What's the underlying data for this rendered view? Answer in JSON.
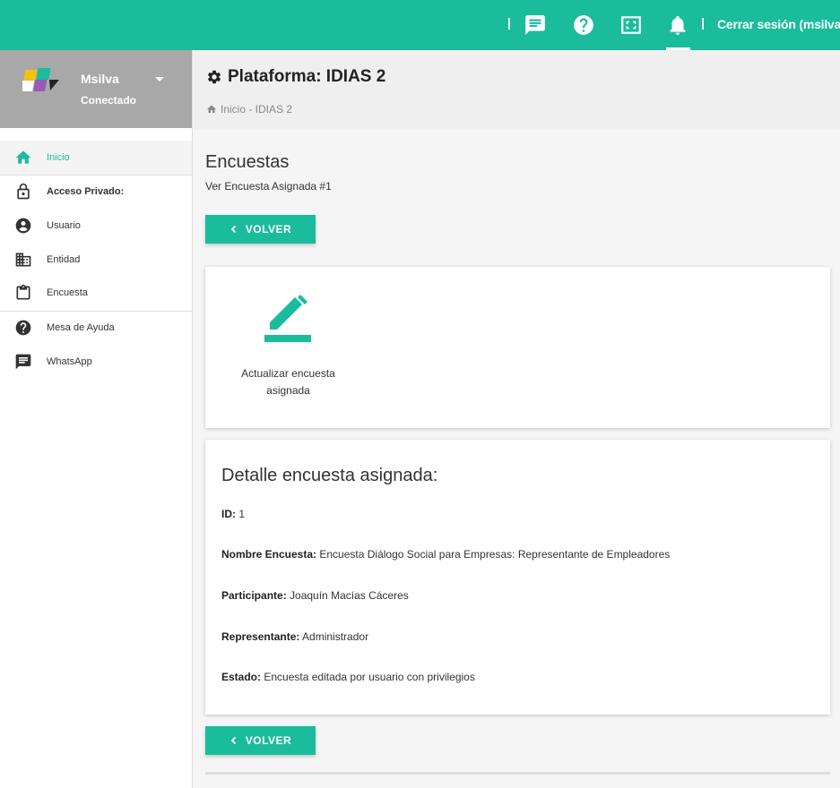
{
  "topbar": {
    "logout_label": "Cerrar sesión (msilva)",
    "icons": [
      "chat-icon",
      "help-icon",
      "fullscreen-icon",
      "bell-icon"
    ],
    "accent": "#1abc9c"
  },
  "user": {
    "name": "Msilva",
    "status": "Conectado"
  },
  "sidebar": {
    "items": [
      {
        "label": "Inicio",
        "icon": "home-icon",
        "active": true
      },
      {
        "label": "Acceso Privado:",
        "icon": "lock-icon",
        "section": true
      },
      {
        "label": "Usuario",
        "icon": "user-circle-icon"
      },
      {
        "label": "Entidad",
        "icon": "building-icon"
      },
      {
        "label": "Encuesta",
        "icon": "clipboard-icon"
      },
      {
        "label": "Mesa de Ayuda",
        "icon": "help-icon"
      },
      {
        "label": "WhatsApp",
        "icon": "chat-icon"
      }
    ]
  },
  "header": {
    "title": "Plataforma: IDIAS 2",
    "breadcrumb": "Inicio - IDIAS 2"
  },
  "main": {
    "section_title": "Encuestas",
    "section_subtitle": "Ver Encuesta Asignada #1",
    "back_label": "VOLVER",
    "action": {
      "label": "Actualizar encuesta asignada",
      "icon": "edit-pencil-icon"
    },
    "detail": {
      "title": "Detalle encuesta asignada:",
      "id_label": "ID:",
      "id_value": "1",
      "name_label": "Nombre Encuesta:",
      "name_value": "Encuesta Diálogo Social para Empresas: Representante de Empleadores",
      "participant_label": "Participante:",
      "participant_value": "Joaquín Macías Cáceres",
      "representative_label": "Representante:",
      "representative_value": "Administrador",
      "status_label": "Estado:",
      "status_value": "Encuesta editada por usuario con privilegios"
    }
  }
}
